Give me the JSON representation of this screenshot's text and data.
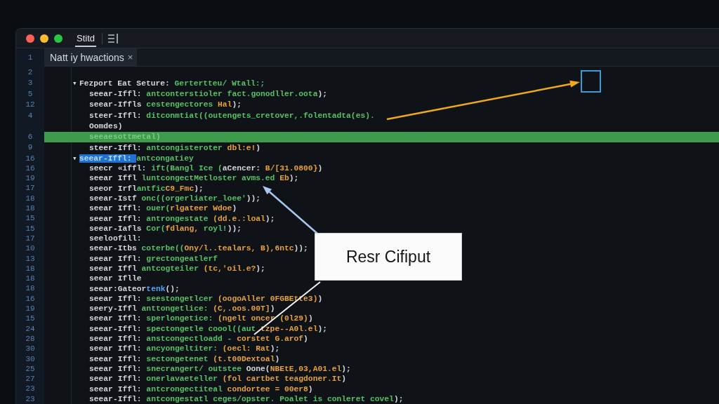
{
  "window": {
    "buttons": [
      {
        "kind": "close"
      },
      {
        "kind": "minimize"
      },
      {
        "kind": "maximize"
      }
    ],
    "tabs": [
      {
        "label": "Stitd",
        "selected": true
      }
    ]
  },
  "editor": {
    "tab": {
      "line_number": "1",
      "label": "Natt iy hwactions",
      "close": "×"
    },
    "lines": [
      {
        "num": "2",
        "highlighted": false
      },
      {
        "num": "3",
        "highlighted": false,
        "fold": "▾",
        "tokens": [
          {
            "kind": "plain",
            "text": "Fezport Eat Seture: "
          },
          {
            "kind": "string",
            "text": "Gertertteu/ Wtall:;"
          }
        ],
        "children": [
          {
            "num": "5",
            "highlighted": false,
            "tokens": [
              {
                "kind": "plain",
                "text": "seear-Iffl: "
              },
              {
                "kind": "string",
                "text": "antconterstioler fact.gonodller.oota"
              },
              {
                "kind": "plain",
                "text": ");"
              }
            ]
          },
          {
            "num": "12",
            "highlighted": false,
            "tokens": [
              {
                "kind": "plain",
                "text": "seear-Iffls "
              },
              {
                "kind": "string",
                "text": "cestengectores "
              },
              {
                "kind": "number",
                "text": "Hal"
              },
              {
                "kind": "plain",
                "text": ");"
              }
            ]
          },
          {
            "num": "4",
            "highlighted": false,
            "tokens": [
              {
                "kind": "plain",
                "text": "steer-Iffl: "
              },
              {
                "kind": "string",
                "text": "ditconmtiat((outengets_cretover,.folentadta(es)."
              }
            ]
          },
          {
            "highlighted": false,
            "tokens": [
              {
                "kind": "plain",
                "text": "Oomdes)"
              }
            ]
          },
          {
            "num": "6",
            "highlighted": true,
            "tokens": [
              {
                "kind": "dim",
                "text": "seeaesottmetal)"
              }
            ]
          },
          {
            "num": "9",
            "highlighted": false,
            "tokens": [
              {
                "kind": "plain",
                "text": "steer-Iffl: "
              },
              {
                "kind": "string",
                "text": "antcongisteroter "
              },
              {
                "kind": "number",
                "text": "dbl:e!"
              },
              {
                "kind": "plain",
                "text": ")"
              }
            ]
          }
        ]
      },
      {
        "num": "16",
        "highlighted": false,
        "fold": "▾",
        "tokens": [
          {
            "kind": "selection",
            "text": "seear-Iffl: "
          },
          {
            "kind": "string",
            "text": "antcongatiey"
          }
        ],
        "children": [
          {
            "num": "16",
            "highlighted": false,
            "tokens": [
              {
                "kind": "plain",
                "text": "seecr «iffl: "
              },
              {
                "kind": "string",
                "text": "ift(Bangl Ice ("
              },
              {
                "kind": "plain",
                "text": "aCencer: "
              },
              {
                "kind": "number",
                "text": "B/[31.0800}"
              },
              {
                "kind": "plain",
                "text": ")"
              }
            ]
          },
          {
            "num": "19",
            "highlighted": false,
            "tokens": [
              {
                "kind": "plain",
                "text": "seear Iffl "
              },
              {
                "kind": "string",
                "text": "luntcongectMetloster avms.ed "
              },
              {
                "kind": "number",
                "text": "Eb"
              },
              {
                "kind": "plain",
                "text": ");"
              }
            ]
          },
          {
            "num": "17",
            "highlighted": false,
            "tokens": [
              {
                "kind": "plain",
                "text": "seeor Irfl"
              },
              {
                "kind": "string",
                "text": "antfic"
              },
              {
                "kind": "number",
                "text": "C9_Fmc"
              },
              {
                "kind": "plain",
                "text": ");"
              }
            ]
          },
          {
            "num": "18",
            "highlighted": false,
            "tokens": [
              {
                "kind": "plain",
                "text": "seear-Istf "
              },
              {
                "kind": "string",
                "text": "onc((orgerliater_loee'"
              },
              {
                "kind": "plain",
                "text": "));"
              }
            ]
          },
          {
            "num": "18",
            "highlighted": false,
            "tokens": [
              {
                "kind": "plain",
                "text": "seear Iffl: "
              },
              {
                "kind": "string",
                "text": "ouer("
              },
              {
                "kind": "number",
                "text": "rlgateer Wdoe"
              },
              {
                "kind": "plain",
                "text": ")"
              }
            ]
          },
          {
            "num": "15",
            "highlighted": false,
            "tokens": [
              {
                "kind": "plain",
                "text": "seear Iffl: "
              },
              {
                "kind": "string",
                "text": "antrongestate "
              },
              {
                "kind": "number",
                "text": "(dd.e.:loal"
              },
              {
                "kind": "plain",
                "text": ");"
              }
            ]
          },
          {
            "num": "15",
            "highlighted": false,
            "tokens": [
              {
                "kind": "plain",
                "text": "seear-Iafls "
              },
              {
                "kind": "string",
                "text": "Cor("
              },
              {
                "kind": "number",
                "text": "fdlang, "
              },
              {
                "kind": "string",
                "text": "royl!"
              },
              {
                "kind": "plain",
                "text": "));"
              }
            ]
          },
          {
            "num": "17",
            "highlighted": false,
            "tokens": [
              {
                "kind": "plain",
                "text": "seeloofill:"
              }
            ]
          },
          {
            "num": "10",
            "highlighted": false,
            "tokens": [
              {
                "kind": "plain",
                "text": "seear-Itbs "
              },
              {
                "kind": "string",
                "text": "coterbe(("
              },
              {
                "kind": "number",
                "text": "Ony/l..tealars, B),6ntc"
              },
              {
                "kind": "plain",
                "text": "));"
              }
            ]
          },
          {
            "num": "13",
            "highlighted": false,
            "tokens": [
              {
                "kind": "plain",
                "text": "seear Iffl: "
              },
              {
                "kind": "string",
                "text": "grectongeatlerf"
              }
            ]
          },
          {
            "num": "18",
            "highlighted": false,
            "tokens": [
              {
                "kind": "plain",
                "text": "seear Iffl "
              },
              {
                "kind": "string",
                "text": "antcogteiler "
              },
              {
                "kind": "number",
                "text": "(tc,'oil.e?"
              },
              {
                "kind": "plain",
                "text": ");"
              }
            ]
          },
          {
            "num": "18",
            "highlighted": false,
            "tokens": [
              {
                "kind": "plain",
                "text": "seear Iflle"
              }
            ]
          },
          {
            "num": "18",
            "highlighted": false,
            "tokens": [
              {
                "kind": "plain",
                "text": "seear:Gateor"
              },
              {
                "kind": "name",
                "text": "tenk"
              },
              {
                "kind": "plain",
                "text": "();"
              }
            ]
          },
          {
            "num": "16",
            "highlighted": false,
            "tokens": [
              {
                "kind": "plain",
                "text": "seear Iffl: "
              },
              {
                "kind": "string",
                "text": "seestongetlcer "
              },
              {
                "kind": "number",
                "text": "(oogoAller 0FGBEtte3)"
              },
              {
                "kind": "plain",
                "text": ")"
              }
            ]
          },
          {
            "num": "19",
            "highlighted": false,
            "tokens": [
              {
                "kind": "plain",
                "text": "seery-Iffl "
              },
              {
                "kind": "string",
                "text": "anttongetlice: "
              },
              {
                "kind": "number",
                "text": "(C,.oos.00T]"
              },
              {
                "kind": "plain",
                "text": ")"
              }
            ]
          },
          {
            "num": "15",
            "highlighted": false,
            "tokens": [
              {
                "kind": "plain",
                "text": "seear Iffl: "
              },
              {
                "kind": "string",
                "text": "sperlongetice: "
              },
              {
                "kind": "number",
                "text": "(ngelt oncer (0l29)"
              },
              {
                "kind": "plain",
                "text": ")"
              }
            ]
          },
          {
            "num": "24",
            "highlighted": false,
            "tokens": [
              {
                "kind": "plain",
                "text": "seear-Iffl: "
              },
              {
                "kind": "string",
                "text": "spectongetle coool((aut "
              },
              {
                "kind": "number",
                "text": "tzpe--A0l.el"
              },
              {
                "kind": "plain",
                "text": ");"
              }
            ]
          },
          {
            "num": "28",
            "highlighted": false,
            "tokens": [
              {
                "kind": "plain",
                "text": "seear Iffl: "
              },
              {
                "kind": "string",
                "text": "anstcongectloadd - "
              },
              {
                "kind": "number",
                "text": "corstet G.arof"
              },
              {
                "kind": "plain",
                "text": ")"
              }
            ]
          },
          {
            "num": "30",
            "highlighted": false,
            "tokens": [
              {
                "kind": "plain",
                "text": "seear Iffl: "
              },
              {
                "kind": "string",
                "text": "ancyongeltiter: "
              },
              {
                "kind": "number",
                "text": "(oecl: Rat"
              },
              {
                "kind": "plain",
                "text": ");"
              }
            ]
          },
          {
            "num": "30",
            "highlighted": false,
            "tokens": [
              {
                "kind": "plain",
                "text": "seear Iffl: "
              },
              {
                "kind": "string",
                "text": "sectongetenet "
              },
              {
                "kind": "number",
                "text": "(t.t00Dextoal"
              },
              {
                "kind": "plain",
                "text": ")"
              }
            ]
          },
          {
            "num": "25",
            "highlighted": false,
            "tokens": [
              {
                "kind": "plain",
                "text": "seear Iffl: "
              },
              {
                "kind": "string",
                "text": "snecrangert/ outstee "
              },
              {
                "kind": "plain",
                "text": "Oone("
              },
              {
                "kind": "number",
                "text": "NBEtE,03,A01.el"
              },
              {
                "kind": "plain",
                "text": ");"
              }
            ]
          },
          {
            "num": "27",
            "highlighted": false,
            "tokens": [
              {
                "kind": "plain",
                "text": "seear Iffl: "
              },
              {
                "kind": "string",
                "text": "onerlavaeteller "
              },
              {
                "kind": "number",
                "text": "(fol cartbet teagdoner.It"
              },
              {
                "kind": "plain",
                "text": ")"
              }
            ]
          },
          {
            "num": "23",
            "highlighted": false,
            "tokens": [
              {
                "kind": "plain",
                "text": "seear Iffl: "
              },
              {
                "kind": "string",
                "text": "antcrongectiteal "
              },
              {
                "kind": "number",
                "text": "condortee = 00er8"
              },
              {
                "kind": "plain",
                "text": ")"
              }
            ]
          },
          {
            "num": "23",
            "highlighted": false,
            "tokens": [
              {
                "kind": "plain",
                "text": "seear-Iffl: "
              },
              {
                "kind": "string",
                "text": "antcongestatl ceges/opster. Poalet is conleret covel"
              },
              {
                "kind": "plain",
                "text": ");"
              }
            ]
          }
        ]
      }
    ]
  },
  "annotations": {
    "callout": "Resr Cifiput"
  }
}
